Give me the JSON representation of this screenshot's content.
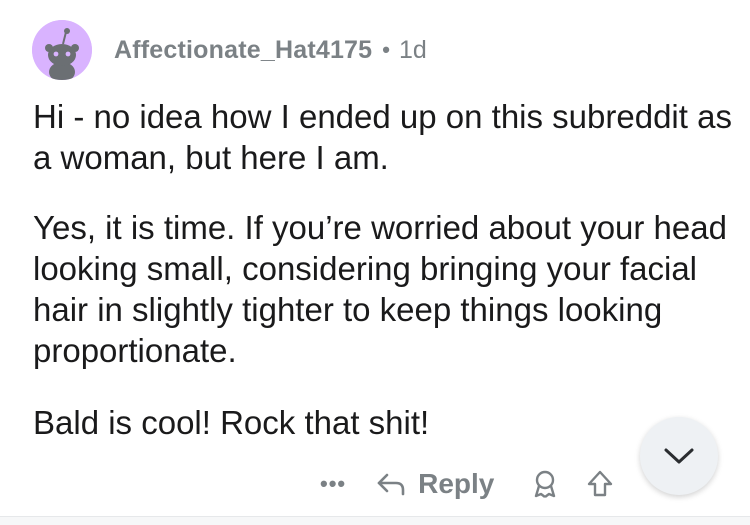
{
  "comment": {
    "username": "Affectionate_Hat4175",
    "separator": "•",
    "age": "1d",
    "paragraphs": [
      "Hi - no idea how I ended up on this subreddit as a woman, but here I am.",
      "Yes, it is time. If you’re worried about your head looking small, considering bringing your facial hair in slightly tighter to keep things looking proportionate.",
      "Bald is cool! Rock that shit!"
    ]
  },
  "actions": {
    "more_label": "•••",
    "reply_label": "Reply"
  },
  "icons": {
    "avatar": "snoo-avatar-icon",
    "reply": "reply-arrow-icon",
    "award": "award-icon",
    "upvote": "upvote-arrow-icon",
    "scroll": "chevron-down-icon"
  },
  "colors": {
    "avatar_bg": "#d9b3ff",
    "meta_text": "#7b8185",
    "body_text": "#1a1a1b"
  }
}
